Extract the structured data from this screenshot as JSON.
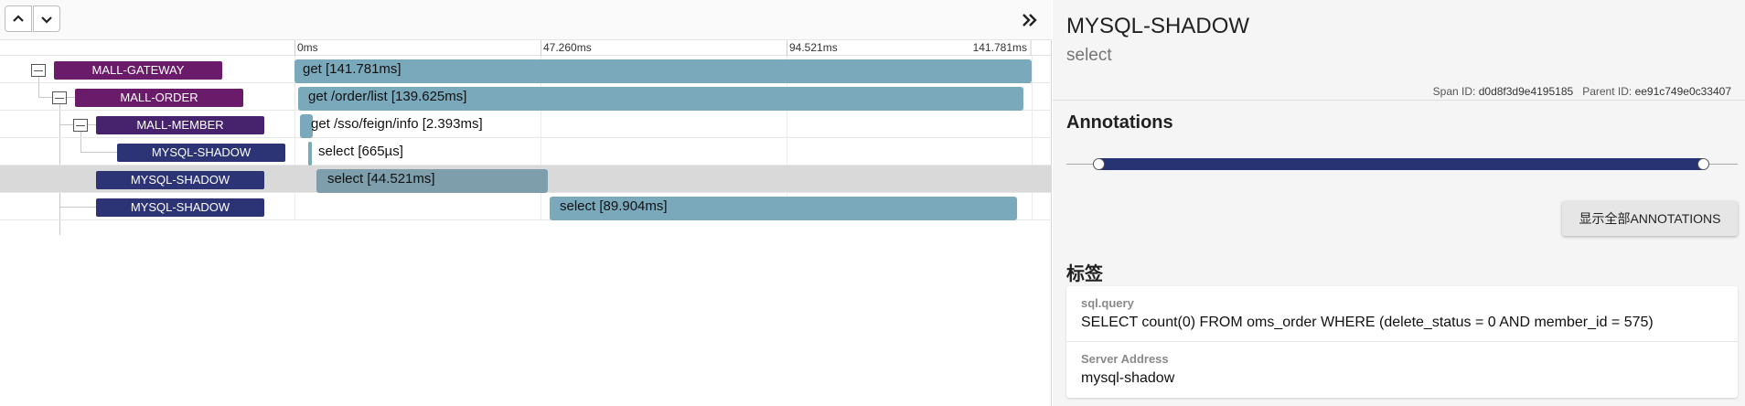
{
  "timeline": {
    "ticks": [
      "0ms",
      "47.260ms",
      "94.521ms",
      "141.781ms"
    ]
  },
  "spans": [
    {
      "service": "MALL-GATEWAY",
      "label": "get [141.781ms]"
    },
    {
      "service": "MALL-ORDER",
      "label": "get /order/list [139.625ms]"
    },
    {
      "service": "MALL-MEMBER",
      "label": "get /sso/feign/info [2.393ms]"
    },
    {
      "service": "MYSQL-SHADOW",
      "label": "select [665µs]"
    },
    {
      "service": "MYSQL-SHADOW",
      "label": "select [44.521ms]"
    },
    {
      "service": "MYSQL-SHADOW",
      "label": "select [89.904ms]"
    }
  ],
  "detail": {
    "service": "MYSQL-SHADOW",
    "name": "select",
    "span_id_label": "Span ID:",
    "span_id": "d0d8f3d9e4195185",
    "parent_id_label": "Parent ID:",
    "parent_id": "ee91c749e0c33407",
    "annotations_title": "Annotations",
    "show_all_label": "显示全部ANNOTATIONS",
    "tags_title": "标签",
    "tags": [
      {
        "key": "sql.query",
        "value": "SELECT count(0) FROM oms_order WHERE (delete_status = 0 AND member_id = 575)"
      },
      {
        "key": "Server Address",
        "value": "mysql-shadow"
      }
    ]
  },
  "colors": {
    "bar": "#7ba9bc",
    "gateway": "#6a1b6a",
    "member": "#47236e",
    "mysql": "#2c3476",
    "annotation_bar": "#283374"
  },
  "icons": {
    "up": "chevron-up-icon",
    "down": "chevron-down-icon",
    "collapse": "double-chevron-right-icon"
  }
}
